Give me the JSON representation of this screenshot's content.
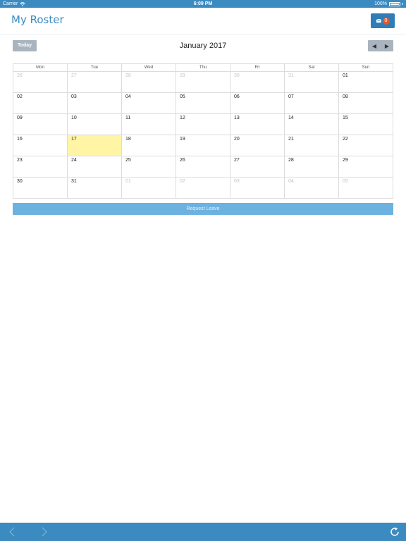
{
  "status": {
    "carrier": "Carrier",
    "time": "6:09 PM",
    "battery": "100%"
  },
  "header": {
    "title": "My Roster",
    "mail_badge": "0"
  },
  "toolbar": {
    "today_label": "Today",
    "month_title": "January 2017",
    "prev_icon": "◀",
    "next_icon": "▶"
  },
  "calendar": {
    "weekdays": [
      "Mon",
      "Tue",
      "Wed",
      "Thu",
      "Fri",
      "Sat",
      "Sun"
    ],
    "weeks": [
      [
        {
          "d": "26",
          "o": 1
        },
        {
          "d": "27",
          "o": 1
        },
        {
          "d": "28",
          "o": 1
        },
        {
          "d": "29",
          "o": 1
        },
        {
          "d": "30",
          "o": 1
        },
        {
          "d": "31",
          "o": 1
        },
        {
          "d": "01"
        }
      ],
      [
        {
          "d": "02"
        },
        {
          "d": "03"
        },
        {
          "d": "04"
        },
        {
          "d": "05"
        },
        {
          "d": "06"
        },
        {
          "d": "07"
        },
        {
          "d": "08"
        }
      ],
      [
        {
          "d": "09"
        },
        {
          "d": "10"
        },
        {
          "d": "11"
        },
        {
          "d": "12"
        },
        {
          "d": "13"
        },
        {
          "d": "14"
        },
        {
          "d": "15"
        }
      ],
      [
        {
          "d": "16"
        },
        {
          "d": "17",
          "t": 1
        },
        {
          "d": "18"
        },
        {
          "d": "19"
        },
        {
          "d": "20"
        },
        {
          "d": "21"
        },
        {
          "d": "22"
        }
      ],
      [
        {
          "d": "23"
        },
        {
          "d": "24"
        },
        {
          "d": "25"
        },
        {
          "d": "26"
        },
        {
          "d": "27"
        },
        {
          "d": "28"
        },
        {
          "d": "29"
        }
      ],
      [
        {
          "d": "30"
        },
        {
          "d": "31"
        },
        {
          "d": "01",
          "o": 1
        },
        {
          "d": "02",
          "o": 1
        },
        {
          "d": "03",
          "o": 1
        },
        {
          "d": "04",
          "o": 1
        },
        {
          "d": "05",
          "o": 1
        }
      ]
    ]
  },
  "request_leave_label": "Request Leave",
  "colors": {
    "accent": "#3b8bc1",
    "today_highlight": "#fff5a5",
    "badge": "#e8552b",
    "request_button": "#6cb2e0"
  },
  "icons": [
    "wifi-icon",
    "battery-icon",
    "mail-icon",
    "back-icon",
    "forward-icon",
    "reload-icon"
  ]
}
